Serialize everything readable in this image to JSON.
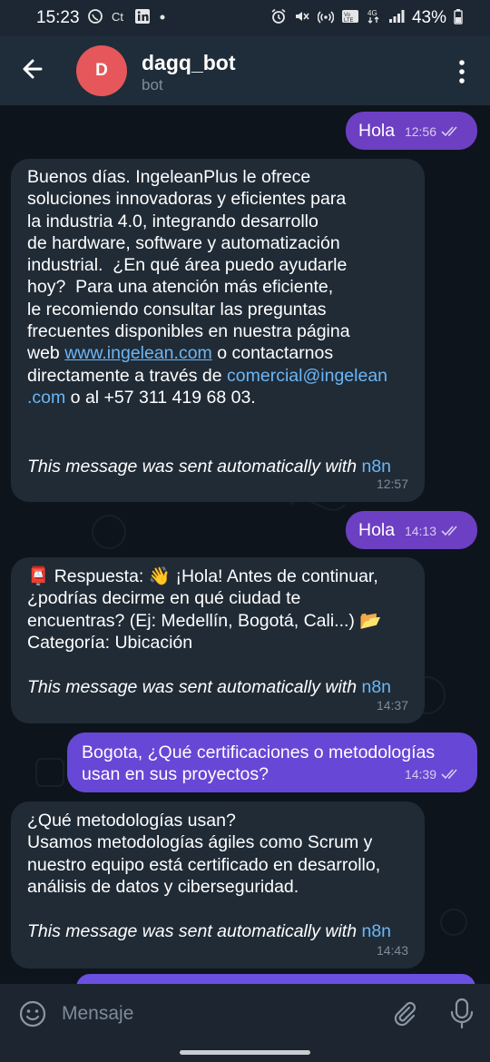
{
  "status_bar": {
    "time": "15:23",
    "left_icons": [
      "whatsapp-icon",
      "ct-icon",
      "linkedin-icon",
      "dot-icon"
    ],
    "right_icons": [
      "alarm-icon",
      "mute-icon",
      "hotspot-icon",
      "volte-icon",
      "4g-icon",
      "signal-icon"
    ],
    "battery": "43%"
  },
  "header": {
    "avatar_initial": "D",
    "title": "dagq_bot",
    "subtitle": "bot"
  },
  "messages": [
    {
      "dir": "out",
      "text": "Hola",
      "time": "12:56",
      "read": true
    },
    {
      "dir": "in",
      "text_parts": [
        "Buenos días. IngeleanPlus le ofrece\nsoluciones innovadoras y eficientes para\nla industria 4.0, integrando desarrollo\nde hardware, software y automatización\nindustrial.  ¿En qué área puedo ayudarle\nhoy?  Para una atención más eficiente,\nle recomiendo consultar las preguntas\nfrecuentes disponibles en nuestra página\nweb ",
        "www.ingelean.com",
        " o contactarnos\ndirectamente a través de ",
        "comercial@ingelean\n.com",
        " o al +57 311 419 68 03."
      ],
      "auto_prefix": "This message was sent automatically with ",
      "auto_link": "n8n",
      "time": "12:57"
    },
    {
      "dir": "out",
      "text": "Hola",
      "time": "14:13",
      "read": true
    },
    {
      "dir": "in",
      "text": "📮 Respuesta: 👋 ¡Hola! Antes de continuar,\n¿podrías decirme en qué ciudad te\nencuentras? (Ej: Medellín, Bogotá, Cali...) 📂\nCategoría: Ubicación",
      "auto_prefix": "This message was sent automatically with ",
      "auto_link": "n8n",
      "time": "14:37"
    },
    {
      "dir": "out",
      "text": "Bogota, ¿Qué certificaciones o metodologías\nusan en sus proyectos?",
      "time": "14:39",
      "read": true
    },
    {
      "dir": "in",
      "text": "¿Qué metodologías usan?\nUsamos metodologías ágiles como Scrum y\nnuestro equipo está certificado en desarrollo,\nanálisis de datos y ciberseguridad.",
      "auto_prefix": "This message was sent automatically with ",
      "auto_link": "n8n",
      "time": "14:43"
    }
  ],
  "input_bar": {
    "placeholder": "Mensaje"
  },
  "colors": {
    "outgoing_bubble": "#6d3fc3",
    "incoming_bubble": "#202b36",
    "link": "#6cb6f5",
    "avatar": "#e5575a"
  }
}
